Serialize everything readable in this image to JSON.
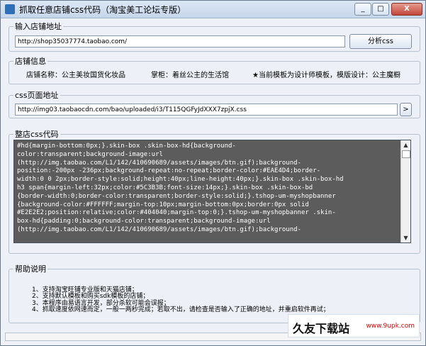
{
  "window": {
    "title": "抓取任意店铺css代码（淘宝美工论坛专版）",
    "min_icon": "minimize-icon",
    "max_icon": "maximize-icon",
    "close_icon": "close-icon",
    "min_glyph": "_",
    "max_glyph": "□",
    "close_glyph": "X"
  },
  "shop_url": {
    "legend": "输入店铺地址",
    "value": "http://shop35037774.taobao.com/",
    "button": "分析css"
  },
  "shop_info": {
    "legend": "店铺信息",
    "name": "店铺名称：公主美妆国货化妆品",
    "owner": "掌柜：着丝公主的生活馆",
    "template": "★当前模板为设计师模板，模版设计：公主魔橱"
  },
  "css_url": {
    "legend": "css页面地址",
    "value": "http://img03.taobaocdn.com/bao/uploaded/i3/T115QGFyJdXXX7zpjX.css",
    "button": ">"
  },
  "css_code": {
    "legend": "整店css代码",
    "text": "#hd{margin-bottom:0px;}.skin-box .skin-box-hd{background-\ncolor:transparent;background-image:url\n(http://img.taobao.com/L1/142/410690689/assets/images/btn.gif);background-\nposition:-200px -236px;background-repeat:no-repeat;border-color:#EAE4D4;border-\nwidth:0 0 2px;border-style:solid;height:40px;line-height:40px;}.skin-box .skin-box-hd\nh3 span{margin-left:32px;color:#5C3B3B;font-size:14px;}.skin-box .skin-box-bd\n{border-width:0;border-color:transparent;border-style:solid;}.tshop-um-myshopbanner\n{background-color:#FFFFFF;margin-top:10px;margin-bottom:0px;border:0px solid\n#E2E2E2;position:relative;color:#404040;margin-top:0;}.tshop-um-myshopbanner .skin-\nbox-hd{padding:0;background-color:transparent;background-image:url\n(http://img.taobao.com/L1/142/410690689/assets/images/btn.gif);background-",
    "scroll_up": "▲",
    "scroll_down": "▼"
  },
  "help": {
    "legend": "帮助说明",
    "text": "1、支持淘宝旺铺专业版和天猫店铺；\n2、支持默认模板和购买sdk模板的店铺；\n3、本程序由易语言开发，部分杀软可能会误报；\n4、抓取速度依网速而定，一般一两秒完成；若取不出，请检查是否输入了正确的地址，并重启软件再试；"
  },
  "watermark": {
    "main": "久友下载站",
    "url": "www.9upk.com"
  }
}
